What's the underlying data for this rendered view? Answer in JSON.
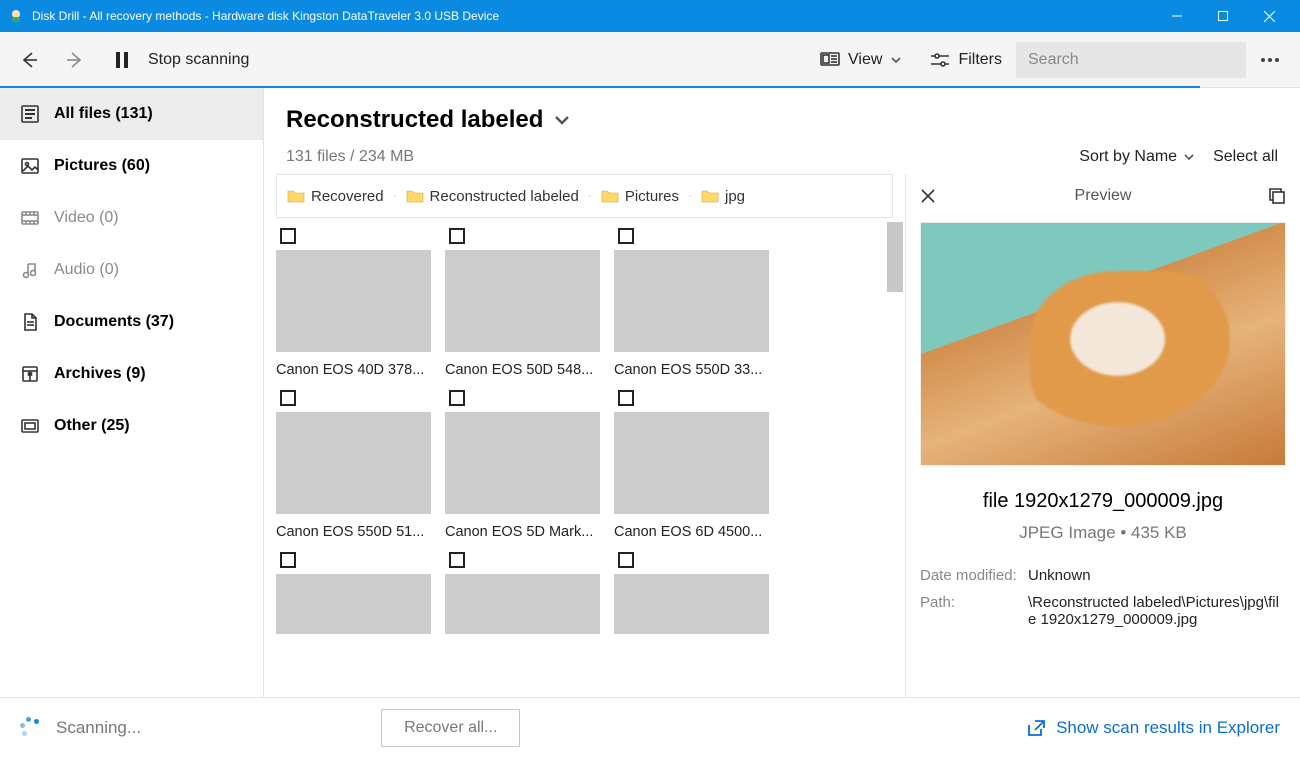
{
  "window": {
    "title": "Disk Drill - All recovery methods - Hardware disk Kingston DataTraveler 3.0 USB Device"
  },
  "toolbar": {
    "stop_label": "Stop scanning",
    "view_label": "View",
    "filters_label": "Filters",
    "search_placeholder": "Search"
  },
  "sidebar": {
    "items": [
      {
        "label": "All files (131)",
        "state": "active"
      },
      {
        "label": "Pictures (60)",
        "state": "bold"
      },
      {
        "label": "Video (0)",
        "state": "muted"
      },
      {
        "label": "Audio (0)",
        "state": "muted"
      },
      {
        "label": "Documents (37)",
        "state": "bold"
      },
      {
        "label": "Archives (9)",
        "state": "bold"
      },
      {
        "label": "Other (25)",
        "state": "bold"
      }
    ]
  },
  "header": {
    "title": "Reconstructed labeled",
    "subtitle": "131 files / 234 MB",
    "sort_label": "Sort by Name",
    "select_all_label": "Select all"
  },
  "breadcrumb": [
    "Recovered",
    "Reconstructed labeled",
    "Pictures",
    "jpg"
  ],
  "files": [
    {
      "name": "Canon EOS 40D 378...",
      "thumb": "th-beach"
    },
    {
      "name": "Canon EOS 50D 548...",
      "thumb": "th-lion"
    },
    {
      "name": "Canon EOS 550D 33...",
      "thumb": "th-girl"
    },
    {
      "name": "Canon EOS 550D 51...",
      "thumb": "th-monkey"
    },
    {
      "name": "Canon EOS 5D Mark...",
      "thumb": "th-family"
    },
    {
      "name": "Canon EOS 6D 4500...",
      "thumb": "th-sunset"
    },
    {
      "name": "",
      "thumb": "th-kids"
    },
    {
      "name": "",
      "thumb": "th-women"
    },
    {
      "name": "",
      "thumb": "th-wedding"
    }
  ],
  "preview": {
    "title": "Preview",
    "filename": "file 1920x1279_000009.jpg",
    "filetype": "JPEG Image • 435 KB",
    "meta": {
      "date_label": "Date modified:",
      "date_value": "Unknown",
      "path_label": "Path:",
      "path_value": "\\Reconstructed labeled\\Pictures\\jpg\\file 1920x1279_000009.jpg"
    }
  },
  "bottom": {
    "status": "Scanning...",
    "recover_label": "Recover all...",
    "explorer_label": "Show scan results in Explorer"
  }
}
